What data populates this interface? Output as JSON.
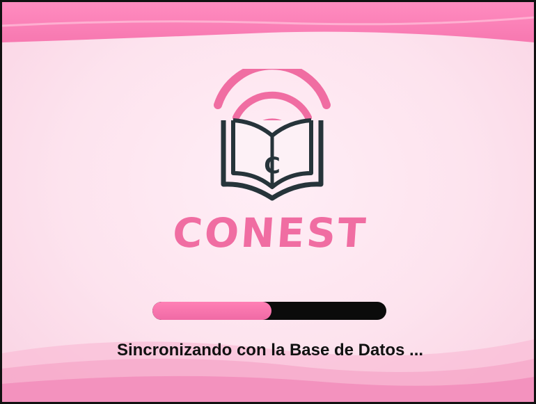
{
  "splash": {
    "brand_name": "CONEST",
    "logo_letter": "C",
    "status_text": "Sincronizando con la Base de Datos ...",
    "progress_fraction": 0.51
  },
  "colors": {
    "accent_pink": "#f06da2",
    "progress_track": "#0b0b0b",
    "book_outline": "#26343a",
    "text_dark": "#111111"
  },
  "icons": {
    "logo": "open-book-wifi-icon"
  }
}
